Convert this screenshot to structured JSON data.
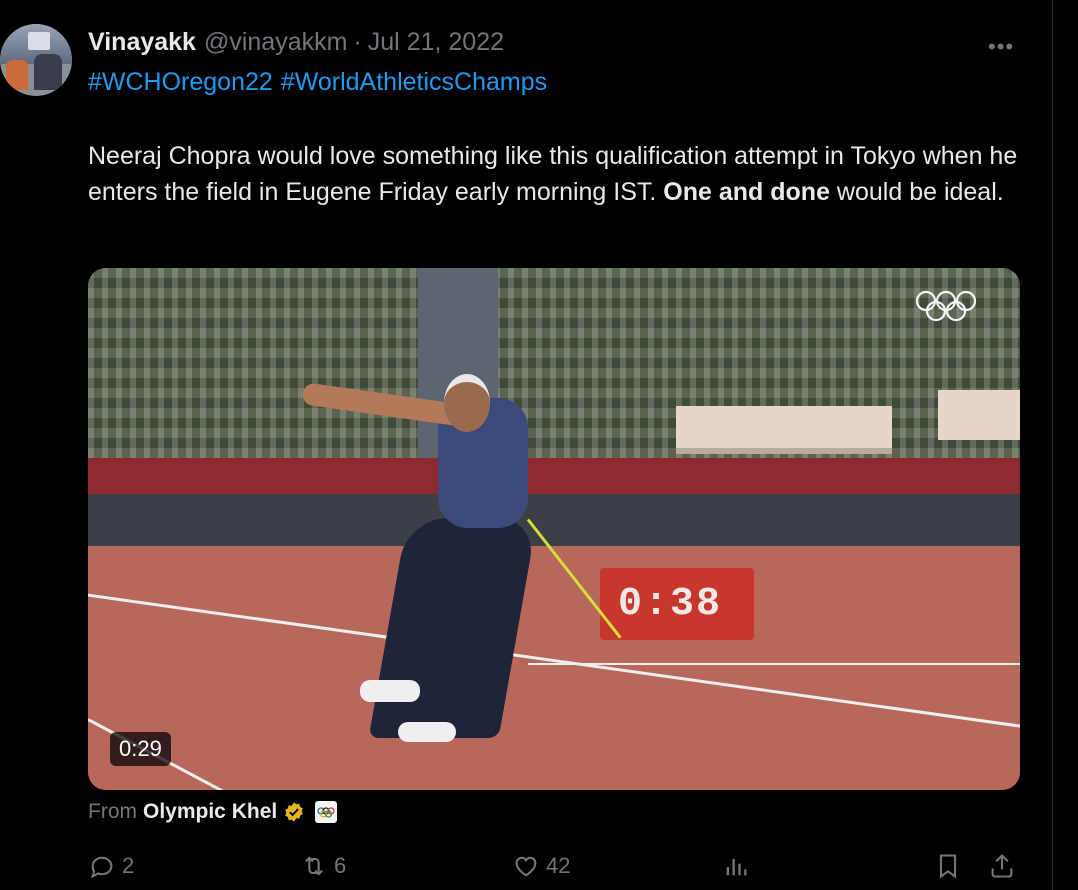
{
  "tweet": {
    "author_name": "Vinayakk",
    "handle": "@vinayakkm",
    "separator": "·",
    "date": "Jul 21, 2022",
    "more_icon": "more-icon",
    "hashtags": [
      "#WCHOregon22",
      "#WorldAthleticsChamps"
    ],
    "text_part1": "Neeraj Chopra would love something like this qualification attempt in Tokyo when he enters the field in Eugene Friday early morning IST. ",
    "text_bold": "One and done",
    "text_part2": " would be ideal."
  },
  "media": {
    "duration": "0:29",
    "scoreboard": "0:38",
    "from_label": "From",
    "source": "Olympic Khel",
    "verified_icon": "verified-badge-gold",
    "source_badge_icon": "olympic-rings-icon"
  },
  "actions": {
    "replies": "2",
    "retweets": "6",
    "likes": "42",
    "icons": [
      "reply-icon",
      "retweet-icon",
      "like-icon",
      "views-icon",
      "bookmark-icon",
      "share-icon"
    ]
  },
  "colors": {
    "background": "#000000",
    "text": "#e7e9ea",
    "muted": "#71767b",
    "link": "#1d9bf0",
    "verified_gold": "#e2b719"
  }
}
